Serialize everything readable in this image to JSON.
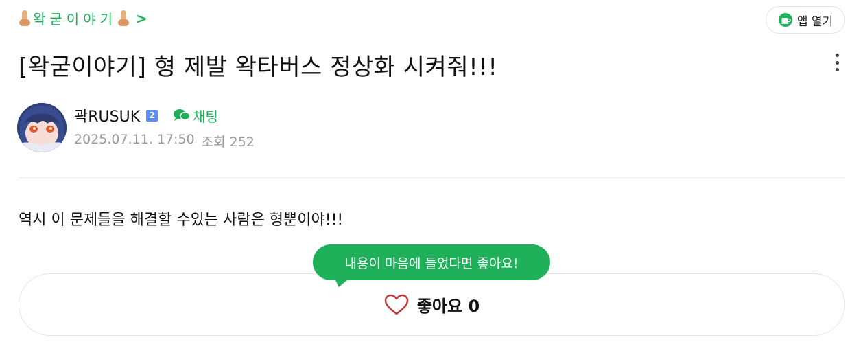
{
  "board": {
    "name": "왁굳이야기",
    "chevron": ">"
  },
  "header": {
    "open_app_label": "앱 열기",
    "open_app_icon": "cup-icon"
  },
  "post": {
    "title": "[왁굳이야기] 형 제발 왁타버스 정상화 시켜줘!!!",
    "author": "곽RUSUK",
    "level": "2",
    "chat_label": "채팅",
    "date": "2025.07.11. 17:50",
    "views": "조회 252",
    "body": "역시 이 문제들을 해결할 수있는 사람은 형뿐이야!!!"
  },
  "like": {
    "tooltip": "내용이 마음에 들었다면 좋아요!",
    "label": "좋아요 0"
  },
  "colors": {
    "brand_green": "#1fb05a",
    "level_badge": "#5b8ef0",
    "meta_gray": "#9a9a9a"
  }
}
